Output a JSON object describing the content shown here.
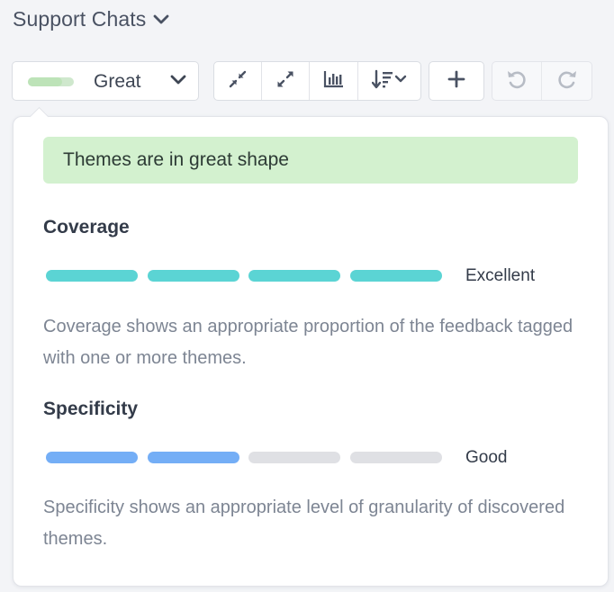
{
  "header": {
    "title": "Support Chats",
    "chevron_icon": "chevron-down-icon"
  },
  "toolbar": {
    "health": {
      "label": "Great",
      "level": 0.75,
      "swatch_color": "#cfe8cd",
      "chevron_icon": "chevron-down-icon"
    },
    "view_buttons": [
      {
        "icon": "collapse-icon"
      },
      {
        "icon": "expand-icon"
      },
      {
        "icon": "bar-chart-icon"
      },
      {
        "icon": "sort-icon"
      }
    ],
    "add_button": {
      "icon": "plus-icon"
    },
    "history_buttons": [
      {
        "icon": "undo-icon"
      },
      {
        "icon": "redo-icon"
      }
    ]
  },
  "popover": {
    "banner": {
      "text": "Themes are in great shape",
      "color": "#d3f1cf"
    },
    "coverage": {
      "title": "Coverage",
      "rating": "Excellent",
      "filled_segments": 4,
      "total_segments": 4,
      "fill_color": "#5bd4d4",
      "description": "Coverage shows an appropriate proportion of the feedback tagged with one or more themes."
    },
    "specificity": {
      "title": "Specificity",
      "rating": "Good",
      "filled_segments": 2,
      "total_segments": 4,
      "fill_color": "#74aef6",
      "description": "Specificity shows an appropriate level of granularity of discovered themes."
    }
  }
}
